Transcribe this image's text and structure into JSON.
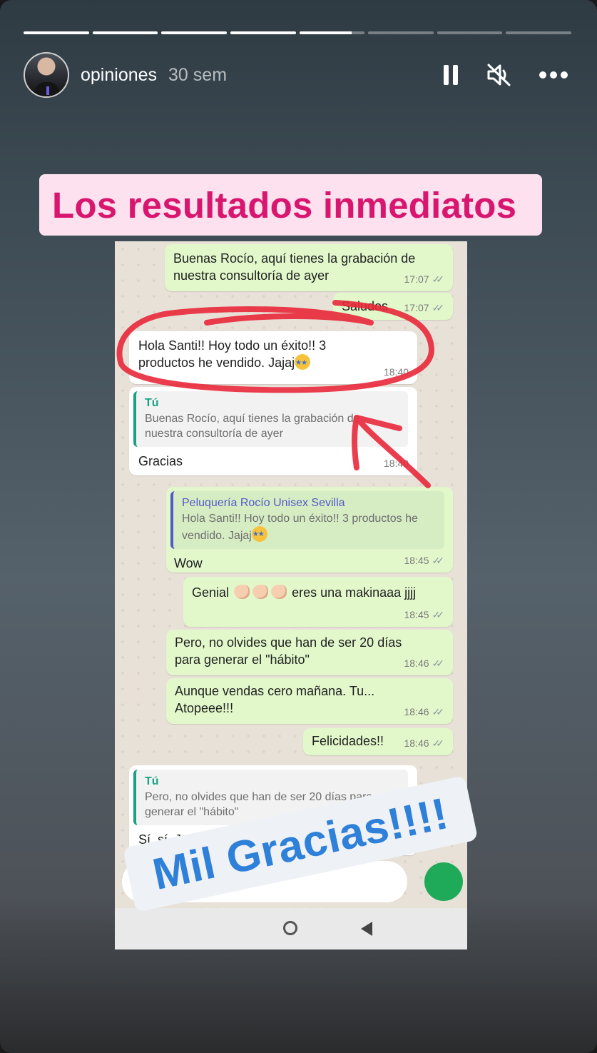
{
  "story": {
    "progress": [
      1,
      1,
      1,
      1,
      0.8,
      0,
      0,
      0
    ],
    "username": "opiniones",
    "time_ago": "30 sem",
    "icons": [
      "pause-icon",
      "muted-speaker-icon",
      "more-options-icon"
    ]
  },
  "stickers": {
    "title": "Los resultados inmediatos",
    "thanks": "Mil Gracias!!!!"
  },
  "chat": {
    "messages": [
      {
        "dir": "out",
        "text": "Buenas Rocío, aquí tienes la grabación de\nnuestra consultoría de ayer",
        "time": "17:07"
      },
      {
        "dir": "out",
        "text": "Saludos",
        "time": "17:07"
      },
      {
        "dir": "in",
        "text": "Hola Santi!! Hoy todo un éxito!! 3\nproductos he vendido. Jajaj",
        "time": "18:40"
      },
      {
        "dir": "in",
        "quote_author": "Tú",
        "quote_text": "Buenas Rocío, aquí tienes la grabación de\nnuestra consultoría de ayer",
        "text": "Gracias",
        "time": "18:40"
      },
      {
        "dir": "out",
        "quote_author": "Peluquería Rocío Unisex Sevilla",
        "quote_text": "Hola Santi!! Hoy todo un éxito!! 3 productos he\nvendido. Jajaj",
        "text": "Wow",
        "time": "18:45"
      },
      {
        "dir": "out",
        "text_before": "Genial",
        "text_after": "eres una makinaaa jjjj",
        "time": "18:45"
      },
      {
        "dir": "out",
        "text": "Pero, no olvides que han de ser 20 días\npara generar el \"hábito\"",
        "time": "18:46"
      },
      {
        "dir": "out",
        "text": "Aunque vendas cero mañana. Tu...\nAtopeee!!!",
        "time": "18:46"
      },
      {
        "dir": "out",
        "text": "Felicidades!!",
        "time": "18:46"
      },
      {
        "dir": "in",
        "quote_author": "Tú",
        "quote_text": "Pero, no olvides que han de ser 20 días para\ngenerar el \"hábito\"",
        "text": "Sí, sí. Jeje",
        "time": ""
      }
    ]
  },
  "colors": {
    "title_text": "#d9166f",
    "title_bg": "#fde1ee",
    "thanks_text": "#2e80d8",
    "annotation_red": "#e8283a",
    "outgoing_bubble": "#e2f8cb"
  }
}
